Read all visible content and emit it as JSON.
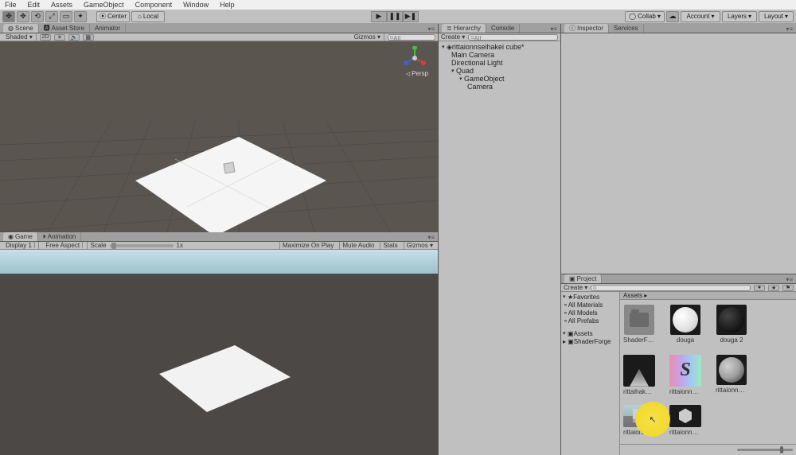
{
  "menubar": [
    "File",
    "Edit",
    "Assets",
    "GameObject",
    "Component",
    "Window",
    "Help"
  ],
  "toolbar": {
    "pivot": "Center",
    "space": "Local",
    "collab": "Collab",
    "account": "Account",
    "layers": "Layers",
    "layout": "Layout"
  },
  "scene_tabs": {
    "scene": "Scene",
    "asset_store": "Asset Store",
    "animator": "Animator"
  },
  "scene_bar": {
    "shading": "Shaded",
    "mode2d": "2D",
    "gizmos": "Gizmos",
    "search_ph": "All"
  },
  "scene": {
    "projection": "Persp"
  },
  "game_tabs": {
    "game": "Game",
    "animation": "Animation"
  },
  "game_bar": {
    "display": "Display 1",
    "aspect": "Free Aspect",
    "scale_label": "Scale",
    "scale_value": "1x",
    "maxplay": "Maximize On Play",
    "mute": "Mute Audio",
    "stats": "Stats",
    "gizmos": "Gizmos"
  },
  "hierarchy": {
    "tab": "Hierarchy",
    "console": "Console",
    "create": "Create",
    "search_ph": "All",
    "root": "rittaionnseihakei cube*",
    "items": [
      "Main Camera",
      "Directional Light",
      "Quad",
      "GameObject",
      "Camera"
    ]
  },
  "inspector": {
    "tab": "Inspector",
    "services": "Services"
  },
  "project": {
    "tab": "Project",
    "create": "Create",
    "search_ph": "",
    "tree": {
      "favorites": "Favorites",
      "fav_items": [
        "All Materials",
        "All Models",
        "All Prefabs"
      ],
      "assets": "Assets",
      "asset_items": [
        "ShaderForge"
      ]
    },
    "path": "Assets ▸",
    "assets": [
      "ShaderForge",
      "douga",
      "douga 2",
      "rittaihakei...",
      "rittaionnsei...",
      "rittaionnsei...",
      "rittaionnsei...",
      "rittaionnsei..."
    ]
  }
}
